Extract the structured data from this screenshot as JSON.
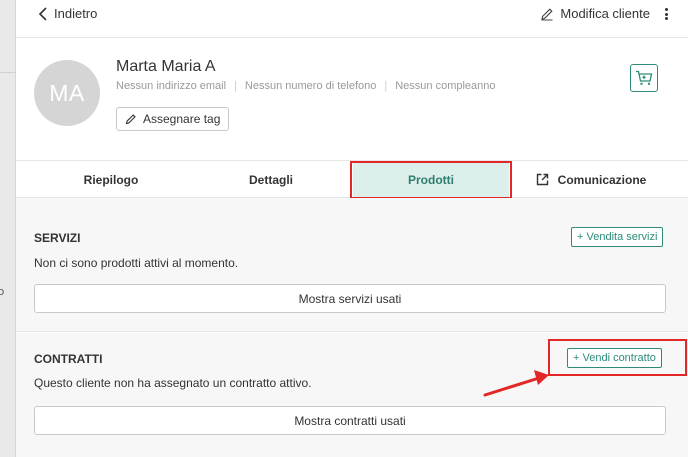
{
  "header": {
    "back_label": "Indietro",
    "edit_label": "Modifica cliente"
  },
  "background": {
    "side_text": "o"
  },
  "customer": {
    "initials": "MA",
    "name": "Marta Maria A",
    "email": "Nessun indirizzo email",
    "phone": "Nessun numero di telefono",
    "birthday": "Nessun compleanno",
    "tag_button": "Assegnare tag"
  },
  "tabs": [
    {
      "label": "Riepilogo",
      "active": false
    },
    {
      "label": "Dettagli",
      "active": false
    },
    {
      "label": "Prodotti",
      "active": true
    },
    {
      "label": "Comunicazione",
      "active": false
    }
  ],
  "services": {
    "title": "SERVIZI",
    "add_button": "+ Vendita servizi",
    "empty_text": "Non ci sono prodotti attivi al momento.",
    "show_used_button": "Mostra servizi usati"
  },
  "contracts": {
    "title": "CONTRATTI",
    "add_button": "+ Vendi contratto",
    "empty_text": "Questo cliente non ha assegnato un contratto attivo.",
    "show_used_button": "Mostra contratti usati"
  },
  "colors": {
    "accent": "#2e8b7a",
    "active_tab_bg": "#dcefea",
    "highlight": "#e32626"
  }
}
